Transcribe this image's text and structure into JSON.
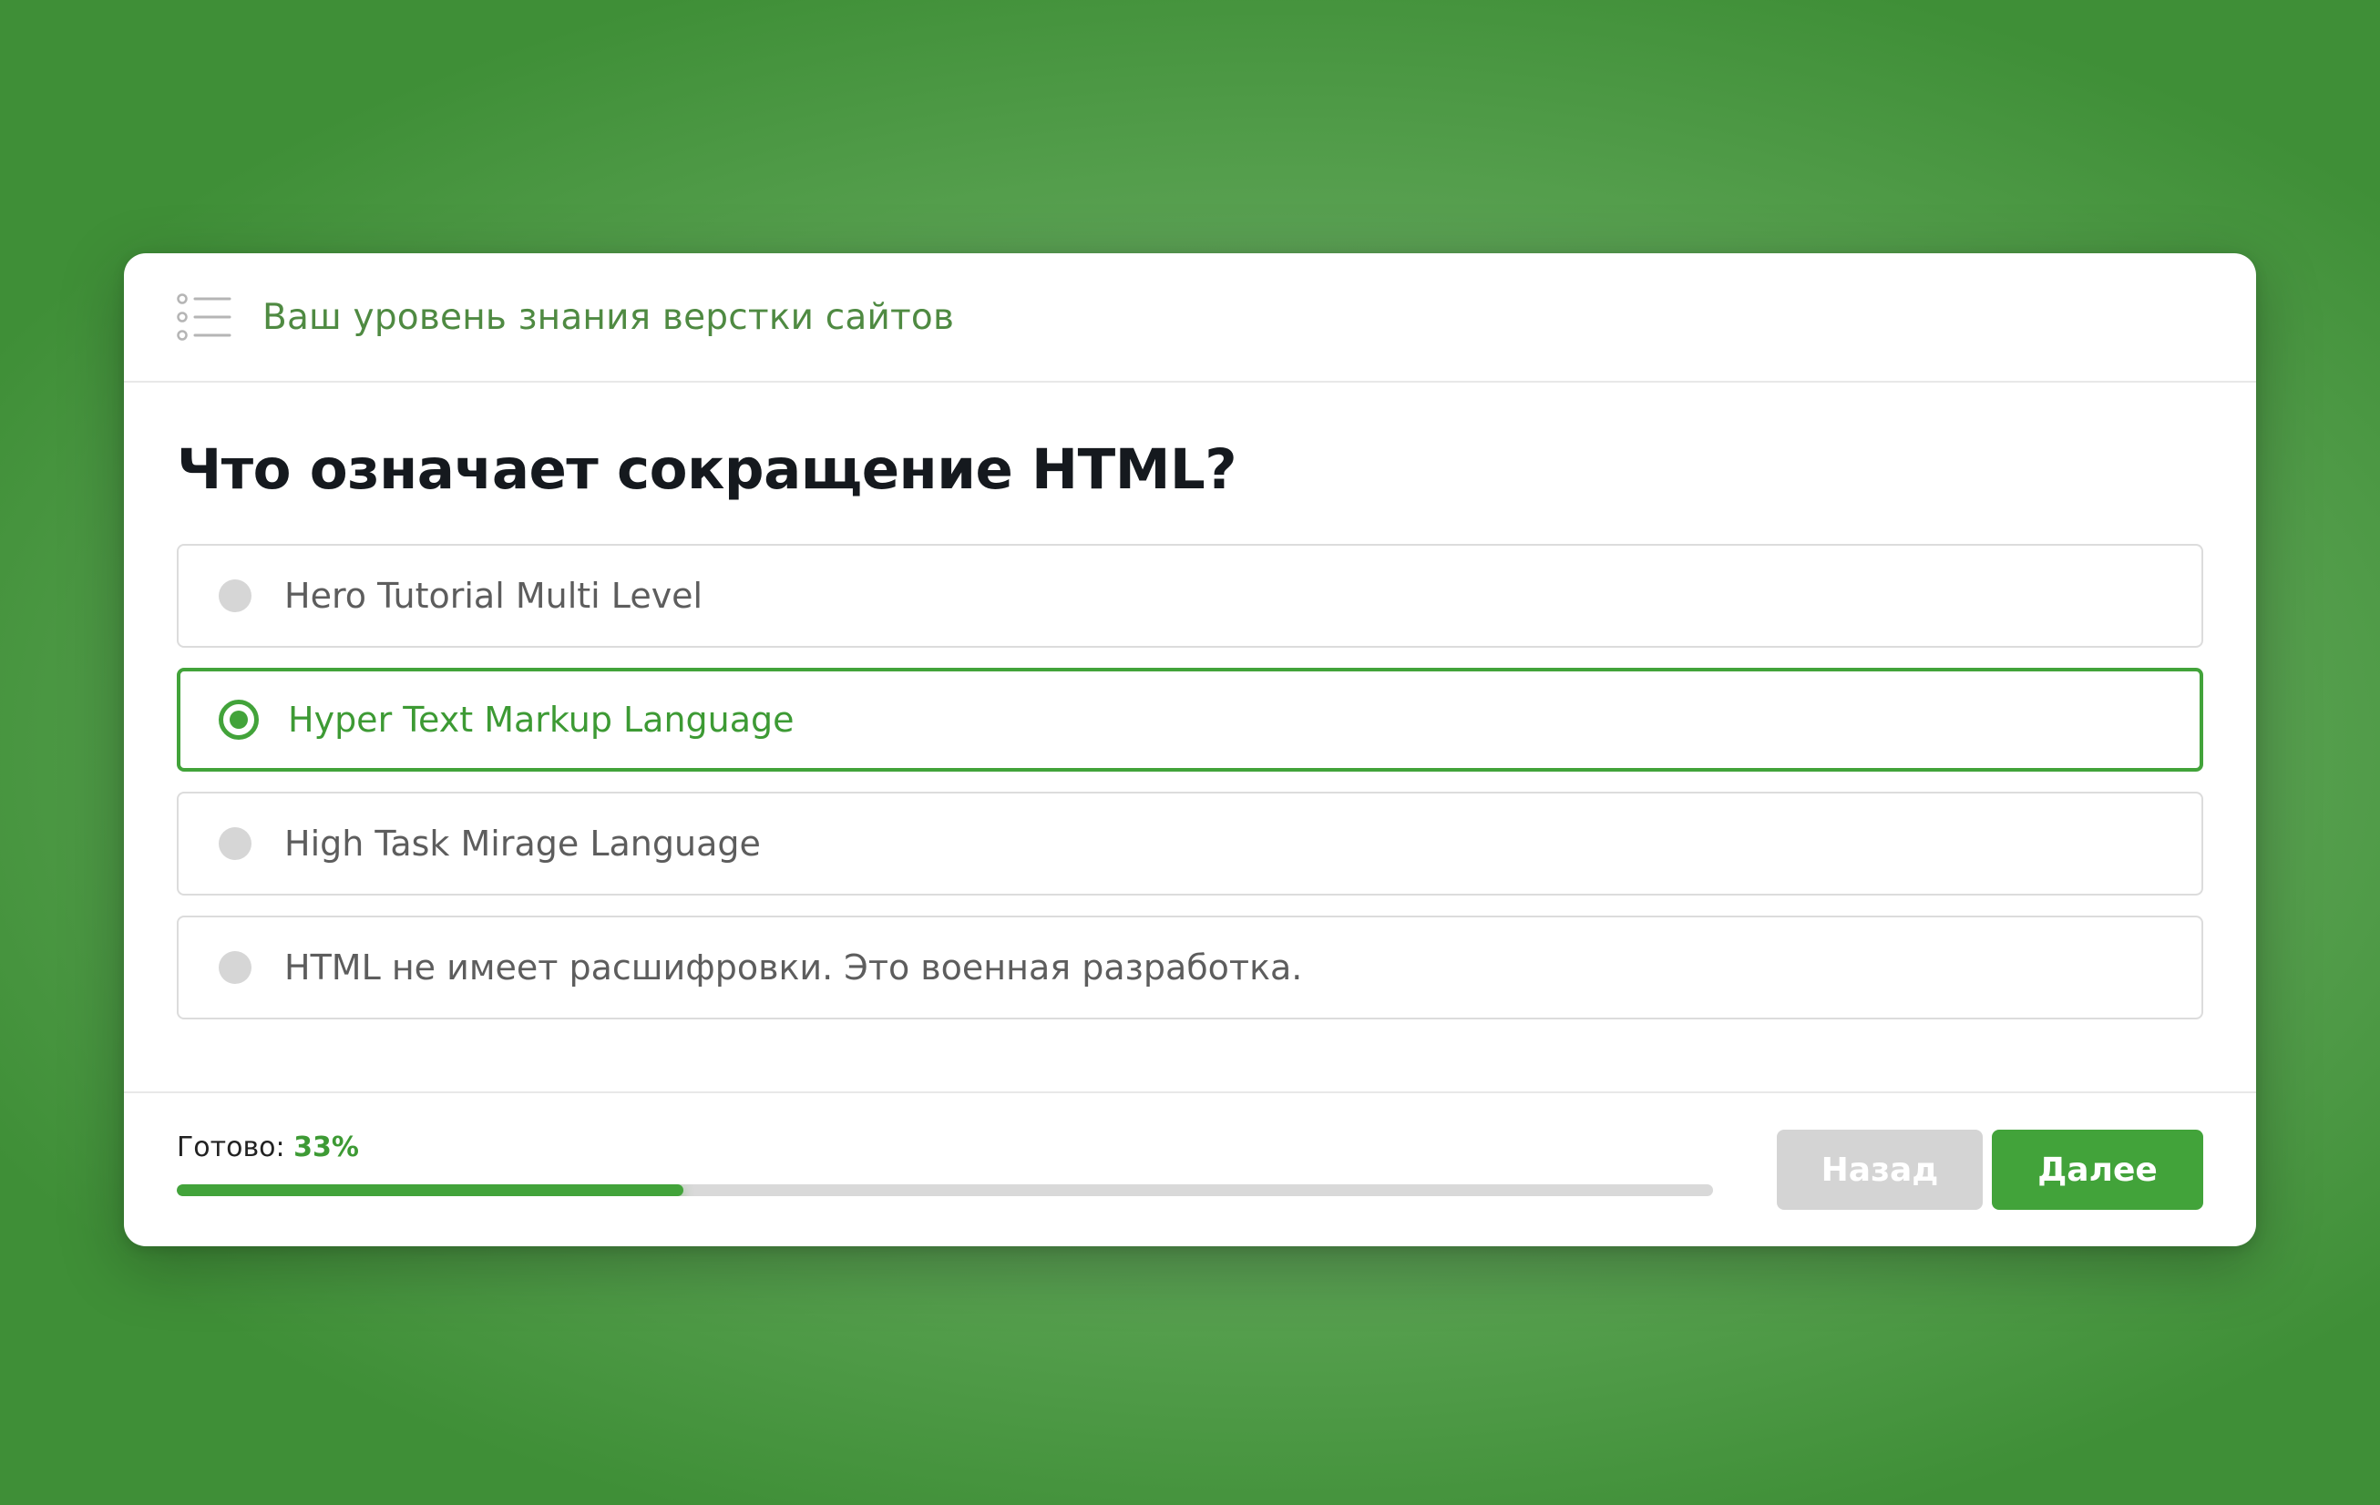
{
  "header": {
    "icon": "list-icon",
    "title": "Ваш уровень знания верстки сайтов"
  },
  "question": {
    "text": "Что означает сокращение HTML?"
  },
  "options": [
    {
      "label": "Hero Tutorial Multi Level",
      "selected": false
    },
    {
      "label": "Hyper Text Markup Language",
      "selected": true
    },
    {
      "label": "High Task Mirage Language",
      "selected": false
    },
    {
      "label": "HTML не имеет расшифровки. Это военная разработка.",
      "selected": false
    }
  ],
  "progress": {
    "label": "Готово:",
    "value_text": "33%",
    "fraction": 0.33
  },
  "buttons": {
    "back_label": "Назад",
    "next_label": "Далее"
  },
  "colors": {
    "accent": "#42a33a",
    "header_text": "#4f8a42",
    "disabled_button": "#d4d4d4"
  }
}
